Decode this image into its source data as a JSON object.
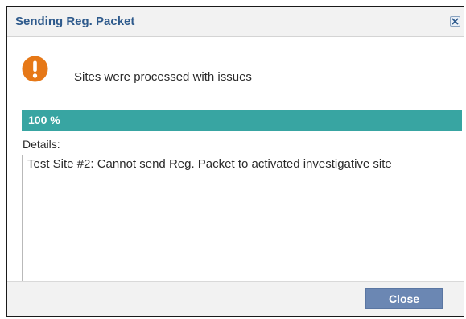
{
  "dialog": {
    "title": "Sending Reg. Packet",
    "close_icon": "close-x-icon"
  },
  "status": {
    "icon": "exclamation-warning-icon",
    "icon_color": "#e67817",
    "message": "Sites were processed with issues"
  },
  "progress": {
    "percent": 100,
    "label": "100 %",
    "color": "#38a5a2"
  },
  "details": {
    "label": "Details:",
    "text": "Test Site #2: Cannot send Reg. Packet to activated investigative site"
  },
  "footer": {
    "close_label": "Close"
  }
}
